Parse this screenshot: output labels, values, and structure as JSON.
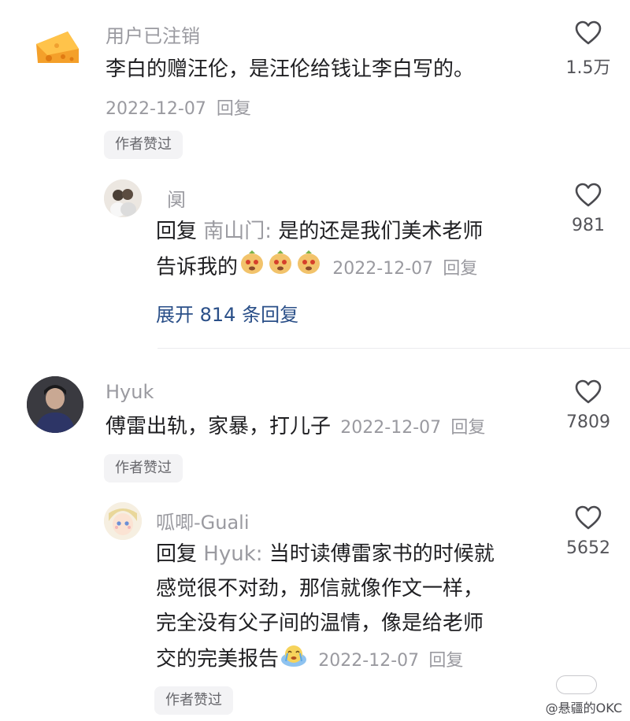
{
  "comments": [
    {
      "username": "用户已注销",
      "content": "李白的赠汪伦，是汪伦给钱让李白写的。",
      "date": "2022-12-07",
      "reply_label": "回复",
      "likes": "1.5万",
      "badge": "作者赞过",
      "avatar_icon": "cheese-avatar",
      "replies": [
        {
          "username": "阒",
          "reply_prefix": "回复",
          "reply_to": "南山门:",
          "content_line1": "是的还是我们美术老师",
          "content_line2": "告诉我的",
          "emoji_icon": "crying-dog-emoji",
          "date": "2022-12-07",
          "reply_label": "回复",
          "likes": "981",
          "expand_text": "展开 814 条回复"
        }
      ]
    },
    {
      "username": "Hyuk",
      "content": "傅雷出轨，家暴，打儿子",
      "date": "2022-12-07",
      "reply_label": "回复",
      "likes": "7809",
      "badge": "作者赞过",
      "avatar_icon": "person-avatar",
      "replies": [
        {
          "username": "呱唧-Guali",
          "reply_prefix": "回复",
          "reply_to": "Hyuk:",
          "content_line1": "当时读傅雷家书的时候就",
          "content_line2": "感觉很不对劲，那信就像作文一样，",
          "content_line3": "完全没有父子间的温情，像是给老师",
          "content_line4": "交的完美报告",
          "emoji_icon": "crying-blob-emoji",
          "date": "2022-12-07",
          "reply_label": "回复",
          "likes": "5652",
          "badge": "作者赞过"
        }
      ]
    }
  ],
  "watermark": "@悬疆的OKC",
  "colors": {
    "muted": "#9a9aa0",
    "link": "#2a4f88",
    "badge_bg": "#f3f3f5"
  }
}
